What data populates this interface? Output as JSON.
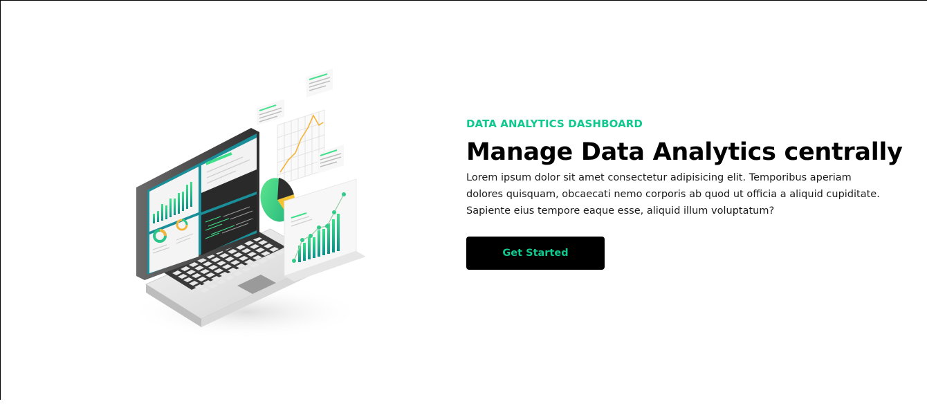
{
  "hero": {
    "eyebrow": "DATA ANALYTICS DASHBOARD",
    "headline": "Manage Data Analytics centrally",
    "body": "Lorem ipsum dolor sit amet consectetur adipisicing elit. Temporibus aperiam dolores quisquam, obcaecati nemo corporis ab quod ut officia a aliquid cupiditate. Sapiente eius tempore eaque esse, aliquid illum voluptatum?",
    "cta_label": "Get Started",
    "illustration_icon": "isometric-laptop-analytics-illustration"
  },
  "colors": {
    "accent": "#10c98f",
    "button_bg": "#000000",
    "text": "#000000"
  }
}
